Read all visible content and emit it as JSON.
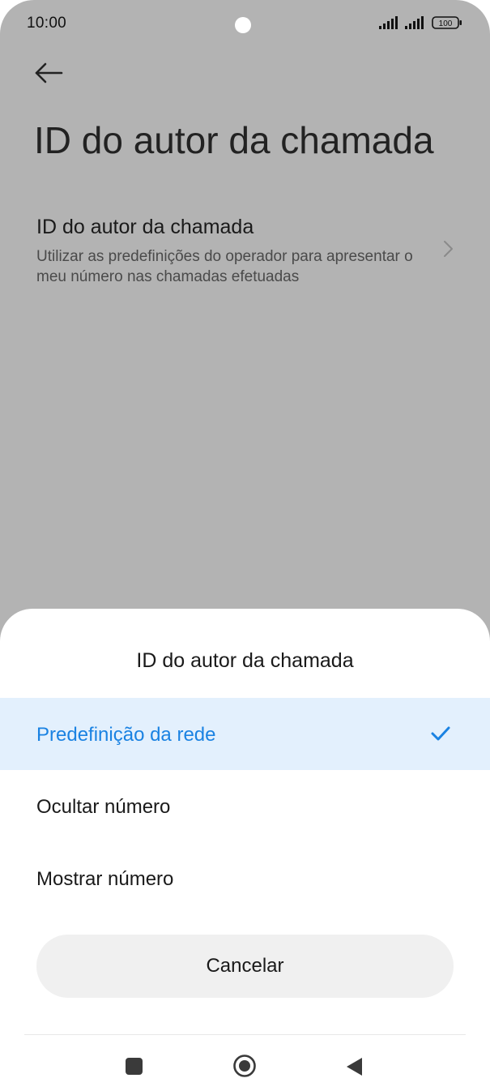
{
  "status_bar": {
    "time": "10:00",
    "battery_level": "100"
  },
  "header": {
    "title": "ID do autor da chamada"
  },
  "setting": {
    "title": "ID do autor da chamada",
    "description": "Utilizar as predefinições do operador para apresentar o meu número nas chamadas efetuadas"
  },
  "sheet": {
    "title": "ID do autor da chamada",
    "options": [
      {
        "label": "Predefinição da rede",
        "selected": true
      },
      {
        "label": "Ocultar número",
        "selected": false
      },
      {
        "label": "Mostrar número",
        "selected": false
      }
    ],
    "cancel_label": "Cancelar"
  },
  "colors": {
    "accent": "#1a82e2",
    "selected_bg": "#e3f0fd",
    "dim_overlay": "#b3b3b3"
  },
  "icons": {
    "back": "arrow-left-icon",
    "chevron": "chevron-right-icon",
    "check": "checkmark-icon",
    "nav_recents": "square-icon",
    "nav_home": "circle-icon",
    "nav_back": "triangle-back-icon"
  }
}
